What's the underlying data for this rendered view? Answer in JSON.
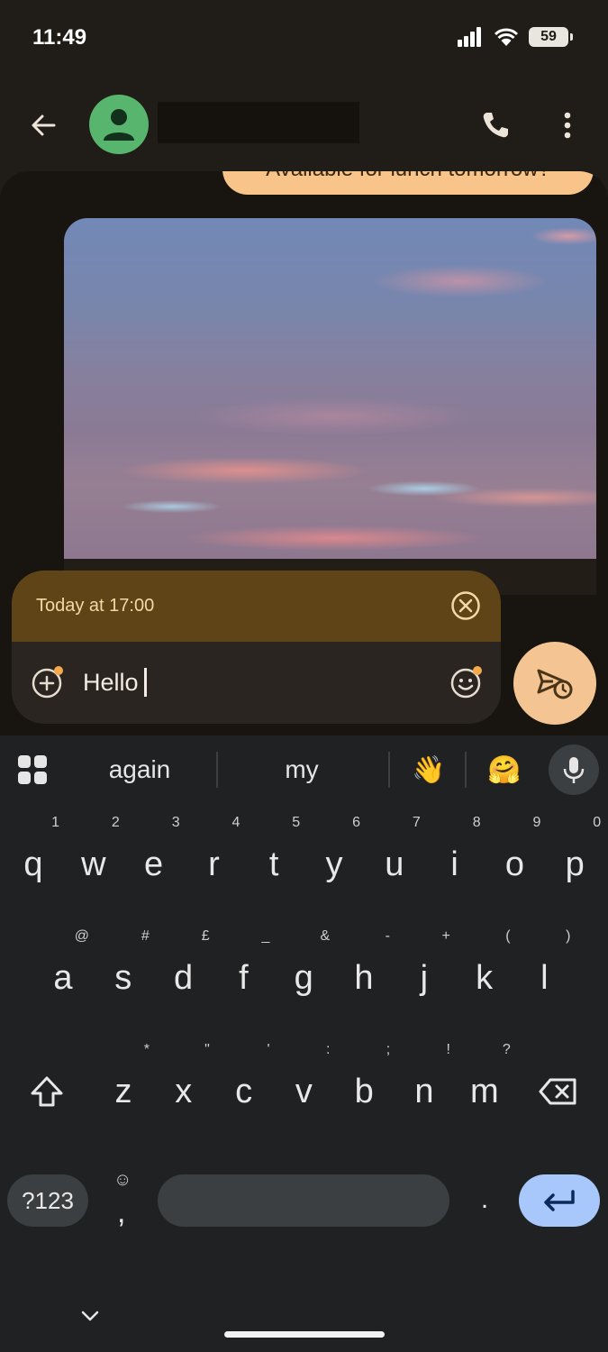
{
  "status_bar": {
    "time": "11:49",
    "battery": "59"
  },
  "header": {
    "contact_name": "",
    "icons": [
      "back-arrow-icon",
      "avatar-person-icon",
      "phone-icon",
      "more-vert-icon"
    ]
  },
  "conversation": {
    "last_outgoing_message": "Available for lunch tomorrow?",
    "image_description_icon": "sunset-clouds-photo"
  },
  "compose": {
    "scheduled_label": "Today at 17:00",
    "message_text": "Hello",
    "icons": [
      "add-attachment-icon",
      "emoji-icon",
      "close-circle-icon",
      "scheduled-send-icon"
    ]
  },
  "keyboard": {
    "suggestions": [
      "again",
      "my",
      "👋",
      "🤗"
    ],
    "row1": [
      {
        "key": "q",
        "hint": "1"
      },
      {
        "key": "w",
        "hint": "2"
      },
      {
        "key": "e",
        "hint": "3"
      },
      {
        "key": "r",
        "hint": "4"
      },
      {
        "key": "t",
        "hint": "5"
      },
      {
        "key": "y",
        "hint": "6"
      },
      {
        "key": "u",
        "hint": "7"
      },
      {
        "key": "i",
        "hint": "8"
      },
      {
        "key": "o",
        "hint": "9"
      },
      {
        "key": "p",
        "hint": "0"
      }
    ],
    "row2": [
      {
        "key": "a",
        "hint": "@"
      },
      {
        "key": "s",
        "hint": "#"
      },
      {
        "key": "d",
        "hint": "£"
      },
      {
        "key": "f",
        "hint": "_"
      },
      {
        "key": "g",
        "hint": "&"
      },
      {
        "key": "h",
        "hint": "-"
      },
      {
        "key": "j",
        "hint": "+"
      },
      {
        "key": "k",
        "hint": "("
      },
      {
        "key": "l",
        "hint": ")"
      }
    ],
    "row3": [
      {
        "key": "z",
        "hint": "*"
      },
      {
        "key": "x",
        "hint": "\""
      },
      {
        "key": "c",
        "hint": "'"
      },
      {
        "key": "v",
        "hint": ":"
      },
      {
        "key": "b",
        "hint": ";"
      },
      {
        "key": "n",
        "hint": "!"
      },
      {
        "key": "m",
        "hint": "?"
      }
    ],
    "symbols_label": "?123",
    "comma": ",",
    "period": ".",
    "comma_emoji_hint": "☺"
  },
  "colors": {
    "accent": "#f4c593",
    "schedule_bar": "#5f4418",
    "enter_key": "#a8c7fa",
    "avatar": "#57b56e"
  }
}
